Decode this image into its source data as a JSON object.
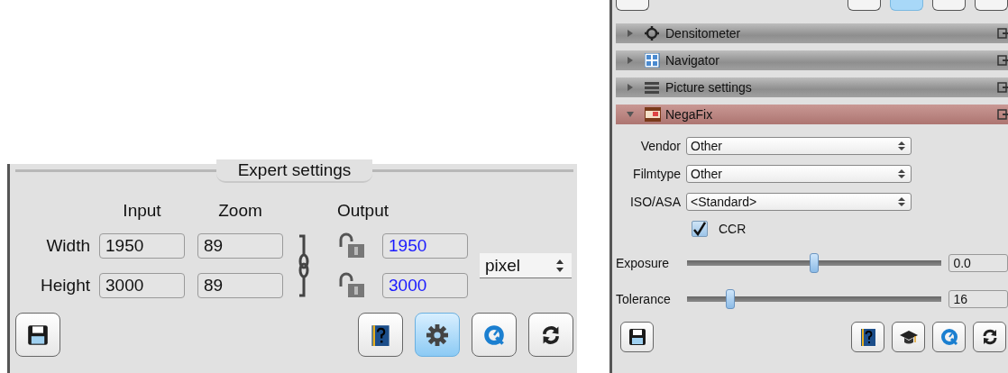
{
  "expert_panel": {
    "title": "Expert settings",
    "column_headers": [
      "Input",
      "Zoom",
      "Output"
    ],
    "rows": [
      {
        "label": "Width",
        "input": "1950",
        "zoom": "89",
        "output": "1950"
      },
      {
        "label": "Height",
        "input": "3000",
        "zoom": "89",
        "output": "3000"
      }
    ],
    "unit": "pixel",
    "buttons_left": [
      {
        "kind": "save",
        "selected": false
      }
    ],
    "buttons_right": [
      {
        "kind": "help",
        "selected": false
      },
      {
        "kind": "gear",
        "selected": true
      },
      {
        "kind": "preview",
        "selected": false
      },
      {
        "kind": "reset",
        "selected": false
      }
    ]
  },
  "side_panel": {
    "top_buttons_left": [
      {
        "selected": false
      }
    ],
    "top_buttons_right": [
      {
        "selected": false
      },
      {
        "selected": true
      },
      {
        "selected": false
      },
      {
        "selected": false
      }
    ],
    "sections": [
      {
        "kind": "crosshair",
        "title": "Densitometer",
        "expanded": false
      },
      {
        "kind": "grid",
        "title": "Navigator",
        "expanded": false
      },
      {
        "kind": "lines",
        "title": "Picture settings",
        "expanded": false
      },
      {
        "kind": "film",
        "title": "NegaFix",
        "expanded": true
      }
    ],
    "fields": [
      {
        "label": "Vendor",
        "value": "Other"
      },
      {
        "label": "Filmtype",
        "value": "Other"
      },
      {
        "label": "ISO/ASA",
        "value": "<Standard>"
      }
    ],
    "ccr": {
      "label": "CCR",
      "checked": true
    },
    "sliders": [
      {
        "label": "Exposure",
        "level": 0.5,
        "value": "0.0"
      },
      {
        "label": "Tolerance",
        "level": 0.17,
        "value": "16"
      }
    ],
    "buttons_left": [
      {
        "kind": "save",
        "selected": false
      }
    ],
    "buttons_right": [
      {
        "kind": "help",
        "selected": false
      },
      {
        "kind": "cap",
        "selected": false
      },
      {
        "kind": "preview",
        "selected": false
      },
      {
        "kind": "reset",
        "selected": false
      }
    ]
  }
}
